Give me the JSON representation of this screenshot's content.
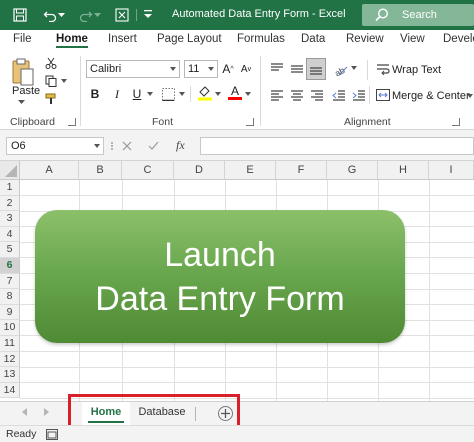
{
  "window": {
    "title": "Automated Data Entry Form  -  Excel"
  },
  "titlebar": {
    "icons": [
      "save-icon",
      "undo-icon",
      "redo-icon",
      "customize-qat-icon"
    ],
    "search_label": "Search"
  },
  "ribbon_tabs": [
    "File",
    "Home",
    "Insert",
    "Page Layout",
    "Formulas",
    "Data",
    "Review",
    "View",
    "Develo"
  ],
  "active_tab": "Home",
  "clipboard": {
    "paste_label": "Paste",
    "group_label": "Clipboard"
  },
  "font": {
    "name": "Calibri",
    "size": "11",
    "group_label": "Font",
    "fill_color": "#ffff00",
    "font_color": "#ff0000"
  },
  "alignment": {
    "wrap_text": "Wrap Text",
    "merge_center": "Merge & Center",
    "group_label": "Alignment"
  },
  "formula_bar": {
    "name_box": "O6",
    "fx": "fx",
    "formula": ""
  },
  "grid": {
    "columns": [
      "A",
      "B",
      "C",
      "D",
      "E",
      "F",
      "G",
      "H",
      "I"
    ],
    "rows": [
      "1",
      "2",
      "3",
      "4",
      "5",
      "6",
      "7",
      "8",
      "9",
      "10",
      "11",
      "12",
      "13",
      "14"
    ],
    "selected_row": "6"
  },
  "launch_button": {
    "line1": "Launch",
    "line2": "Data Entry Form",
    "color": "#6aa84f"
  },
  "sheets": {
    "tabs": [
      "Home",
      "Database"
    ],
    "active": "Home"
  },
  "status": {
    "text": "Ready"
  },
  "colors": {
    "excel_green": "#217346",
    "highlight_red": "#d81f2a"
  }
}
